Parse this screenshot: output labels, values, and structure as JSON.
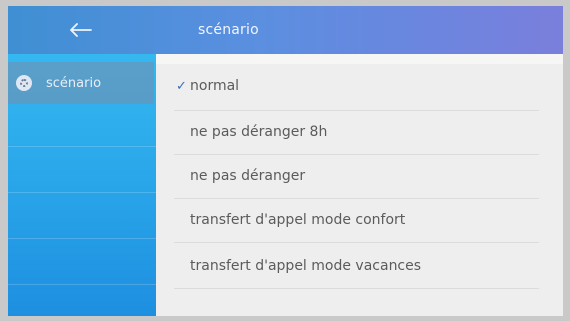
{
  "header": {
    "title": "scénario",
    "back_icon": "left-arrow-icon"
  },
  "sidebar": {
    "items": [
      {
        "label": "scénario",
        "icon": "scenario-icon",
        "selected": true
      }
    ]
  },
  "menu": {
    "options": [
      {
        "label": "normal",
        "checked": true
      },
      {
        "label": "ne pas déranger 8h",
        "checked": false
      },
      {
        "label": "ne pas déranger",
        "checked": false
      },
      {
        "label": "transfert d'appel mode confort",
        "checked": false
      },
      {
        "label": "transfert d'appel mode vacances",
        "checked": false
      }
    ],
    "check_glyph": "✓"
  },
  "colors": {
    "header_start": "#3f8fd3",
    "header_end": "#7a7fdc",
    "sidebar": "#2aa7ea",
    "menu_bg": "#efeeee",
    "text": "#5b5b5b",
    "check": "#3a6fb5"
  }
}
